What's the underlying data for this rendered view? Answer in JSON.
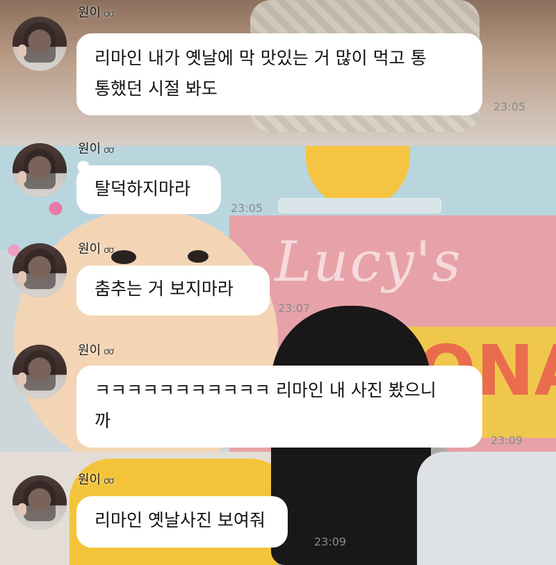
{
  "chat": {
    "messages": [
      {
        "sender": "원이",
        "badge": "ơơ",
        "text": "리마인 내가 옛날에 막 맛있는 거 많이 먹고 통\n통했던 시절 봐도",
        "time": "23:05"
      },
      {
        "sender": "원이",
        "badge": "ơơ",
        "text": "탈덕하지마라",
        "time": "23:05"
      },
      {
        "sender": "원이",
        "badge": "ơơ",
        "text": "춤추는 거 보지마라",
        "time": "23:07"
      },
      {
        "sender": "원이",
        "badge": "ơơ",
        "text": "ㅋㅋㅋㅋㅋㅋㅋㅋㅋㅋㅋ 리마인 내 사진 봤으니\n까",
        "time": "23:09"
      },
      {
        "sender": "원이",
        "badge": "ơơ",
        "text": "리마인 옛날사진 보여줘",
        "time": "23:09"
      }
    ]
  },
  "background": {
    "sign_text": "Lucy's",
    "sign_text_2": "ONA"
  },
  "colors": {
    "bubble": "#ffffff",
    "time": "#8a8a8a"
  }
}
